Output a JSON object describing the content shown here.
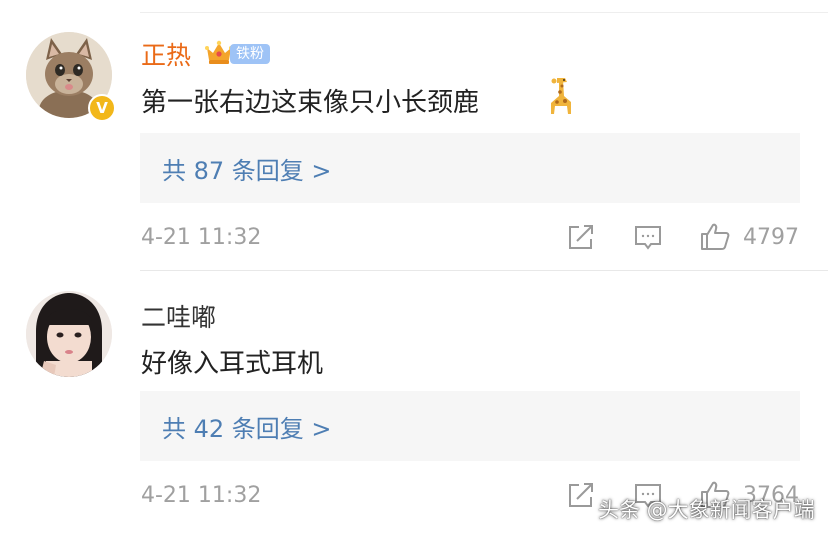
{
  "comments": [
    {
      "user_name": "正热",
      "fan_badge": "铁粉",
      "verified_badge": "V",
      "text": "第一张右边这束像只小长颈鹿",
      "emoji": "giraffe-emoji",
      "reply_link": "共 87 条回复 >",
      "timestamp": "4-21 11:32",
      "like_count": "4797"
    },
    {
      "user_name": "二哇嘟",
      "text": "好像入耳式耳机",
      "reply_link": "共 42 条回复 >",
      "timestamp": "4-21 11:32",
      "like_count": "3764"
    }
  ],
  "watermark": "头条 @大象新闻客户端",
  "colors": {
    "username_highlight": "#ea6a17",
    "reply_link": "#4e7eb3",
    "meta_gray": "#a0a0a0",
    "reply_box_bg": "#f6f6f6",
    "fan_badge_bg": "#9ec3f6",
    "verified_badge": "#f2b71a"
  }
}
